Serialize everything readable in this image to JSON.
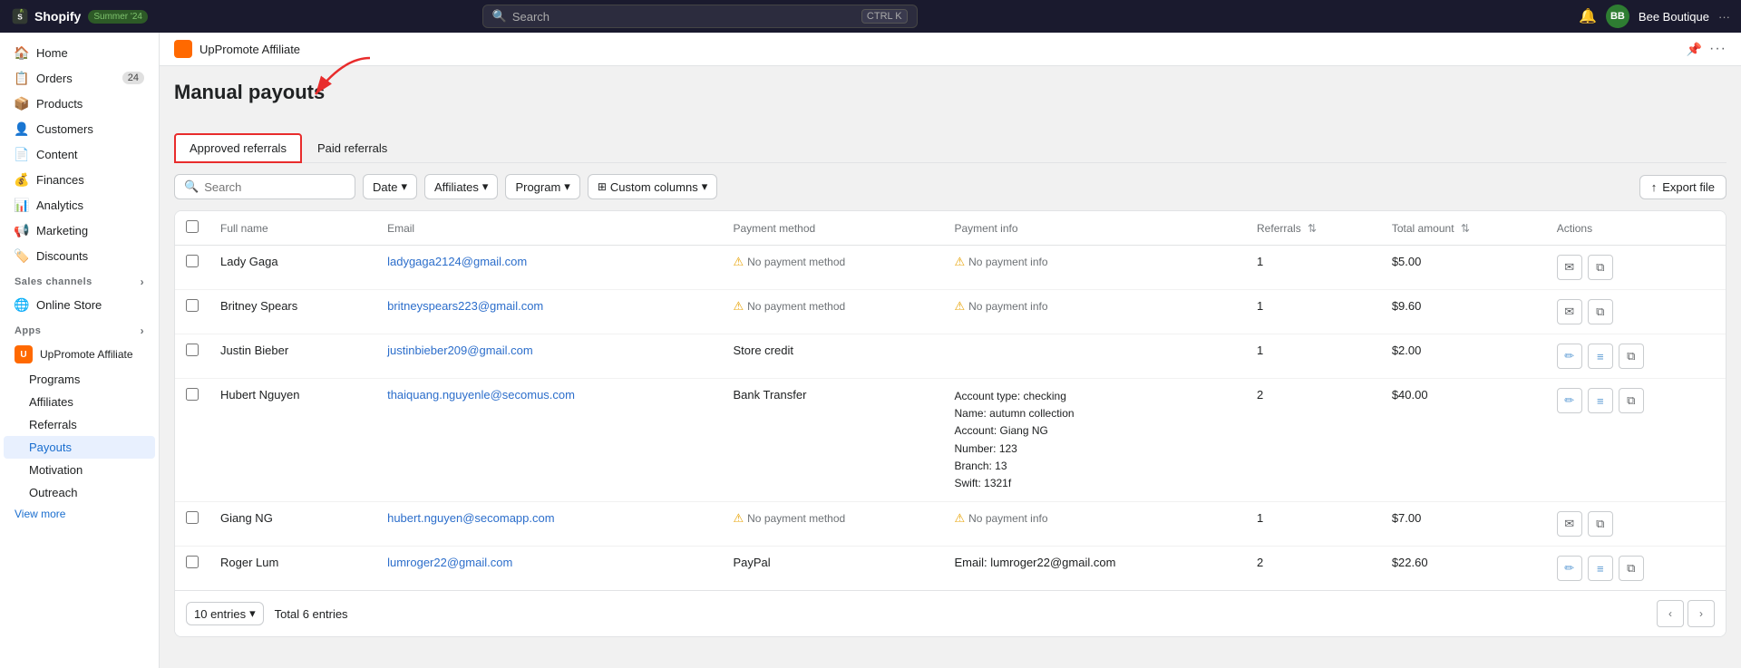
{
  "topbar": {
    "logo": "Shopify",
    "season_badge": "Summer '24",
    "search_placeholder": "Search",
    "search_shortcut": "CTRL K",
    "notification_icon": "bell-icon",
    "avatar_initials": "BB",
    "store_name": "Bee Boutique"
  },
  "sidebar": {
    "main_items": [
      {
        "id": "home",
        "label": "Home",
        "icon": "🏠",
        "badge": null
      },
      {
        "id": "orders",
        "label": "Orders",
        "icon": "📋",
        "badge": "24"
      },
      {
        "id": "products",
        "label": "Products",
        "icon": "📦",
        "badge": null
      },
      {
        "id": "customers",
        "label": "Customers",
        "icon": "👤",
        "badge": null
      },
      {
        "id": "content",
        "label": "Content",
        "icon": "📄",
        "badge": null
      },
      {
        "id": "finances",
        "label": "Finances",
        "icon": "💰",
        "badge": null
      },
      {
        "id": "analytics",
        "label": "Analytics",
        "icon": "📊",
        "badge": null
      },
      {
        "id": "marketing",
        "label": "Marketing",
        "icon": "📢",
        "badge": null
      },
      {
        "id": "discounts",
        "label": "Discounts",
        "icon": "🏷️",
        "badge": null
      }
    ],
    "sales_channels_label": "Sales channels",
    "sales_channels": [
      {
        "id": "online-store",
        "label": "Online Store",
        "icon": "🌐"
      }
    ],
    "apps_label": "Apps",
    "app_name": "UpPromote Affiliate",
    "app_sub_items": [
      {
        "id": "programs",
        "label": "Programs"
      },
      {
        "id": "affiliates",
        "label": "Affiliates"
      },
      {
        "id": "referrals",
        "label": "Referrals"
      },
      {
        "id": "payouts",
        "label": "Payouts",
        "active": true
      },
      {
        "id": "motivation",
        "label": "Motivation"
      },
      {
        "id": "outreach",
        "label": "Outreach"
      }
    ],
    "view_more_label": "View more"
  },
  "app_header": {
    "app_name": "UpPromote Affiliate"
  },
  "page": {
    "title": "Manual payouts",
    "tabs": [
      {
        "id": "approved",
        "label": "Approved referrals",
        "active": true
      },
      {
        "id": "paid",
        "label": "Paid referrals",
        "active": false
      }
    ],
    "toolbar": {
      "search_placeholder": "Search",
      "date_filter": "Date",
      "affiliates_filter": "Affiliates",
      "program_filter": "Program",
      "custom_columns_filter": "Custom columns",
      "export_label": "Export file"
    },
    "table": {
      "columns": [
        {
          "id": "full_name",
          "label": "Full name",
          "sortable": false
        },
        {
          "id": "email",
          "label": "Email",
          "sortable": false
        },
        {
          "id": "payment_method",
          "label": "Payment method",
          "sortable": false
        },
        {
          "id": "payment_info",
          "label": "Payment info",
          "sortable": false
        },
        {
          "id": "referrals",
          "label": "Referrals",
          "sortable": true
        },
        {
          "id": "total_amount",
          "label": "Total amount",
          "sortable": true
        },
        {
          "id": "actions",
          "label": "Actions",
          "sortable": false
        }
      ],
      "rows": [
        {
          "id": 1,
          "full_name": "Lady Gaga",
          "email": "ladygaga2124@gmail.com",
          "payment_method": "No payment method",
          "payment_method_warning": true,
          "payment_info": "No payment info",
          "payment_info_warning": true,
          "referrals": "1",
          "total_amount": "$5.00",
          "actions": [
            "email",
            "copy"
          ]
        },
        {
          "id": 2,
          "full_name": "Britney Spears",
          "email": "britneyspears223@gmail.com",
          "payment_method": "No payment method",
          "payment_method_warning": true,
          "payment_info": "No payment info",
          "payment_info_warning": true,
          "referrals": "1",
          "total_amount": "$9.60",
          "actions": [
            "email",
            "copy"
          ]
        },
        {
          "id": 3,
          "full_name": "Justin Bieber",
          "email": "justinbieber209@gmail.com",
          "payment_method": "Store credit",
          "payment_method_warning": false,
          "payment_info": "",
          "payment_info_warning": false,
          "referrals": "1",
          "total_amount": "$2.00",
          "actions": [
            "edit",
            "list",
            "copy"
          ]
        },
        {
          "id": 4,
          "full_name": "Hubert Nguyen",
          "email": "thaiquang.nguyenle@secomus.com",
          "payment_method": "Bank Transfer",
          "payment_method_warning": false,
          "payment_info_multi": [
            "Account type: checking",
            "Name: autumn collection",
            "Account: Giang NG",
            "Number: 123",
            "Branch: 13",
            "Swift: 1321f"
          ],
          "payment_info_warning": false,
          "referrals": "2",
          "total_amount": "$40.00",
          "actions": [
            "edit",
            "list",
            "copy"
          ]
        },
        {
          "id": 5,
          "full_name": "Giang NG",
          "email": "hubert.nguyen@secomapp.com",
          "payment_method": "No payment method",
          "payment_method_warning": true,
          "payment_info": "No payment info",
          "payment_info_warning": true,
          "referrals": "1",
          "total_amount": "$7.00",
          "actions": [
            "email",
            "copy"
          ]
        },
        {
          "id": 6,
          "full_name": "Roger Lum",
          "email": "lumroger22@gmail.com",
          "payment_method": "PayPal",
          "payment_method_warning": false,
          "payment_info": "Email: lumroger22@gmail.com",
          "payment_info_warning": false,
          "referrals": "2",
          "total_amount": "$22.60",
          "actions": [
            "edit",
            "list",
            "copy"
          ]
        }
      ]
    },
    "footer": {
      "entries_label": "10 entries",
      "total_label": "Total 6 entries"
    }
  }
}
